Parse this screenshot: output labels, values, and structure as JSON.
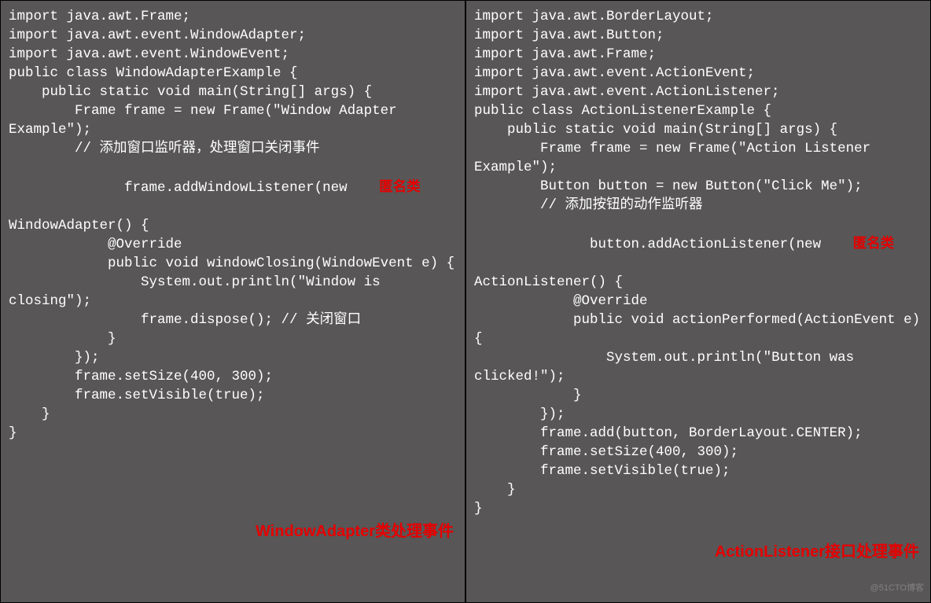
{
  "left": {
    "l1": "import java.awt.Frame;",
    "l2": "import java.awt.event.WindowAdapter;",
    "l3": "import java.awt.event.WindowEvent;",
    "l4": "",
    "l5": "public class WindowAdapterExample {",
    "l6": "    public static void main(String[] args) {",
    "l7": "        Frame frame = new Frame(\"Window Adapter Example\");",
    "l8": "",
    "l9": "        // 添加窗口监听器，处理窗口关闭事件",
    "l10a": "        frame.addWindowListener(new ",
    "l10_anno": "匿名类",
    "l11": "WindowAdapter() {",
    "l12": "            @Override",
    "l13": "            public void windowClosing(WindowEvent e) {",
    "l14": "                System.out.println(\"Window is closing\");",
    "l15": "                frame.dispose(); // 关闭窗口",
    "l16": "            }",
    "l17": "        });",
    "l18": "",
    "l19": "        frame.setSize(400, 300);",
    "l20": "        frame.setVisible(true);",
    "l21": "    }",
    "l22": "}",
    "caption": "WindowAdapter类处理事件"
  },
  "right": {
    "r1": "import java.awt.BorderLayout;",
    "r2": "import java.awt.Button;",
    "r3": "import java.awt.Frame;",
    "r4": "import java.awt.event.ActionEvent;",
    "r5": "import java.awt.event.ActionListener;",
    "r6": "",
    "r7": "public class ActionListenerExample {",
    "r8": "    public static void main(String[] args) {",
    "r9": "        Frame frame = new Frame(\"Action Listener Example\");",
    "r10": "        Button button = new Button(\"Click Me\");",
    "r11": "",
    "r12": "        // 添加按钮的动作监听器",
    "r13a": "        button.addActionListener(new ",
    "r13_anno": "匿名类",
    "r14": "ActionListener() {",
    "r15": "            @Override",
    "r16": "            public void actionPerformed(ActionEvent e) {",
    "r17": "                System.out.println(\"Button was clicked!\");",
    "r18": "            }",
    "r19": "        });",
    "r20": "",
    "r21": "        frame.add(button, BorderLayout.CENTER);",
    "r22": "        frame.setSize(400, 300);",
    "r23": "        frame.setVisible(true);",
    "r24": "    }",
    "r25": "}",
    "caption": "ActionListener接口处理事件"
  },
  "watermark": "@51CTO博客"
}
